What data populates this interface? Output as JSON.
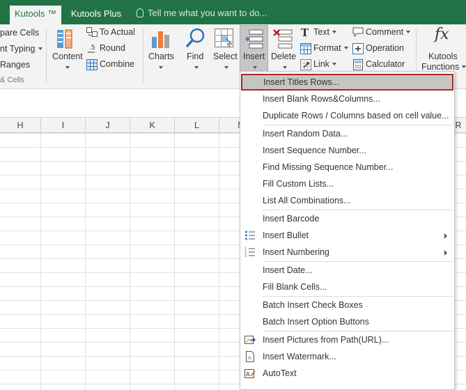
{
  "tabs": {
    "active": "Kutools ™",
    "plus": "Kutools Plus",
    "tell_me": "Tell me what you want to do..."
  },
  "ribbon": {
    "left_items": [
      "pare Cells",
      "nt Typing",
      "Ranges"
    ],
    "left_group_label": "& Cells",
    "content_label": "Content",
    "to_actual": "To Actual",
    "round": "Round",
    "combine": "Combine",
    "charts": "Charts",
    "find": "Find",
    "select": "Select",
    "insert": "Insert",
    "delete": "Delete",
    "text": "Text",
    "format": "Format",
    "link": "Link",
    "comment": "Comment",
    "operation": "Operation",
    "calculator": "Calculator",
    "kutools_functions_1": "Kutools",
    "kutools_functions_2": "Functions",
    "fx": "fx"
  },
  "columns": [
    "H",
    "I",
    "J",
    "K",
    "L",
    "M",
    "R"
  ],
  "menu": {
    "items": [
      "Insert Titles Rows...",
      "Insert Blank Rows&Columns...",
      "Duplicate Rows / Columns based on cell value...",
      "Insert Random Data...",
      "Insert Sequence Number...",
      "Find Missing Sequence Number...",
      "Fill Custom Lists...",
      "List All Combinations...",
      "Insert Barcode",
      "Insert Bullet",
      "Insert Numbering",
      "Insert Date...",
      "Fill Blank Cells...",
      "Batch Insert Check Boxes",
      "Batch Insert Option Buttons",
      "Insert Pictures from Path(URL)...",
      "Insert Watermark...",
      "AutoText"
    ]
  },
  "colors": {
    "excel_green": "#217346",
    "highlight_border": "#a52a2a"
  }
}
